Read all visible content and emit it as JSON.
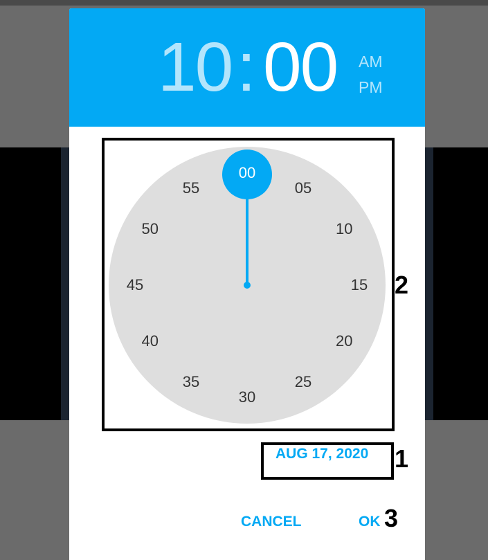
{
  "picker": {
    "hour": "10",
    "separator": ":",
    "minute": "00",
    "am_label": "AM",
    "pm_label": "PM"
  },
  "clock": {
    "minutes": [
      "00",
      "05",
      "10",
      "15",
      "20",
      "25",
      "30",
      "35",
      "40",
      "45",
      "50",
      "55"
    ],
    "selected": "00"
  },
  "date_link": "AUG 17, 2020",
  "buttons": {
    "cancel": "CANCEL",
    "ok": "OK"
  },
  "annotations": {
    "clock_label": "2",
    "date_label": "1",
    "ok_label": "3"
  },
  "colors": {
    "accent": "#03a9f4",
    "header_dim_text": "#b3e5fc",
    "clock_face": "#dedede"
  }
}
